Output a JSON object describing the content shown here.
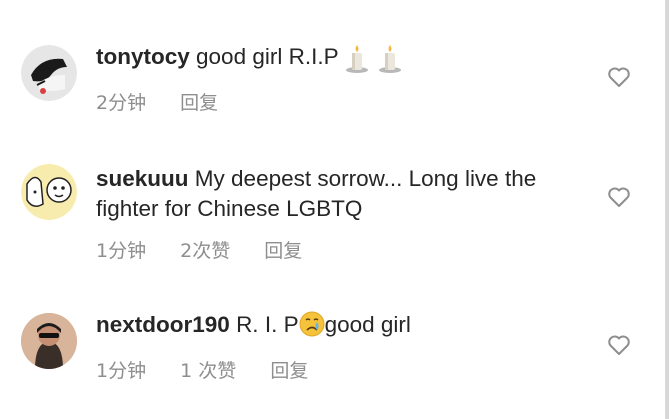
{
  "comments": [
    {
      "username": "tonytocy",
      "text": "good girl  R.I.P",
      "time": "2分钟",
      "likes": "",
      "reply": "回复",
      "emojis": [
        "candle-icon",
        "candle-icon"
      ]
    },
    {
      "username": "suekuuu",
      "text": "My deepest sorrow... Long live the fighter for Chinese LGBTQ",
      "time": "1分钟",
      "likes": "2次赞",
      "reply": "回复"
    },
    {
      "username": "nextdoor190",
      "text_before": "R. I. P",
      "text_after": "good girl",
      "time": "1分钟",
      "likes": "1 次赞",
      "reply": "回复",
      "emojis": [
        "crying-face-icon"
      ]
    }
  ],
  "colors": {
    "text": "#262626",
    "meta": "#8e8e8e",
    "heart": "#8e8e8e"
  }
}
